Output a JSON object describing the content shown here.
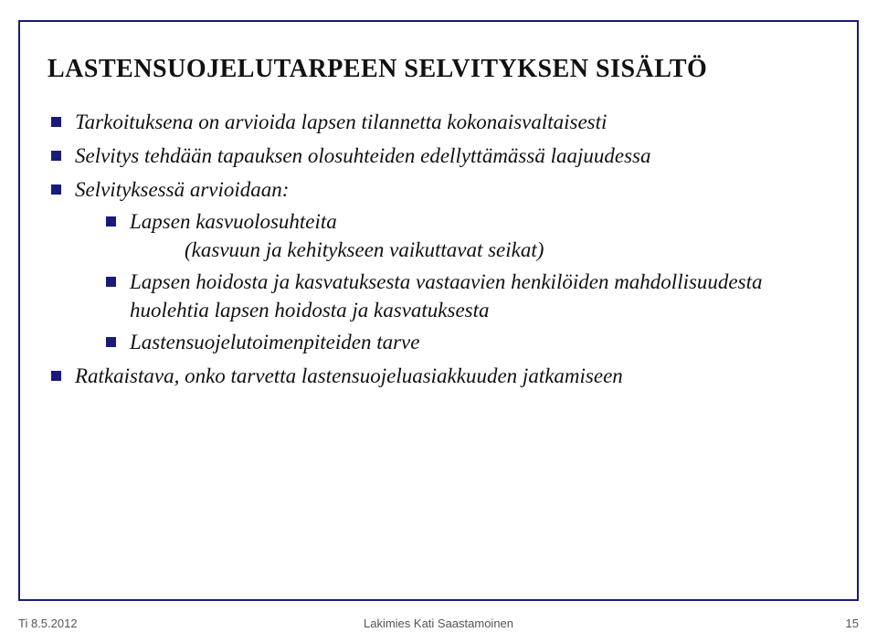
{
  "title": "LASTENSUOJELUTARPEEN SELVITYKSEN SISÄLTÖ",
  "bullets": {
    "b1": "Tarkoituksena on arvioida lapsen tilannetta kokonaisvaltaisesti",
    "b2": "Selvitys tehdään tapauksen olosuhteiden edellyttämässä laajuudessa",
    "b3": "Selvityksessä arvioidaan:",
    "b3_1": "Lapsen kasvuolosuhteita",
    "b3_1_paren": "(kasvuun ja kehitykseen vaikuttavat seikat)",
    "b3_2": "Lapsen hoidosta ja kasvatuksesta vastaavien henkilöiden mahdollisuudesta huolehtia lapsen hoidosta ja kasvatuksesta",
    "b3_3": "Lastensuojelutoimenpiteiden tarve",
    "b4": "Ratkaistava, onko tarvetta lastensuojeluasiakkuuden jatkamiseen"
  },
  "footer": {
    "left": "Ti 8.5.2012",
    "center": "Lakimies Kati Saastamoinen",
    "right": "15"
  }
}
